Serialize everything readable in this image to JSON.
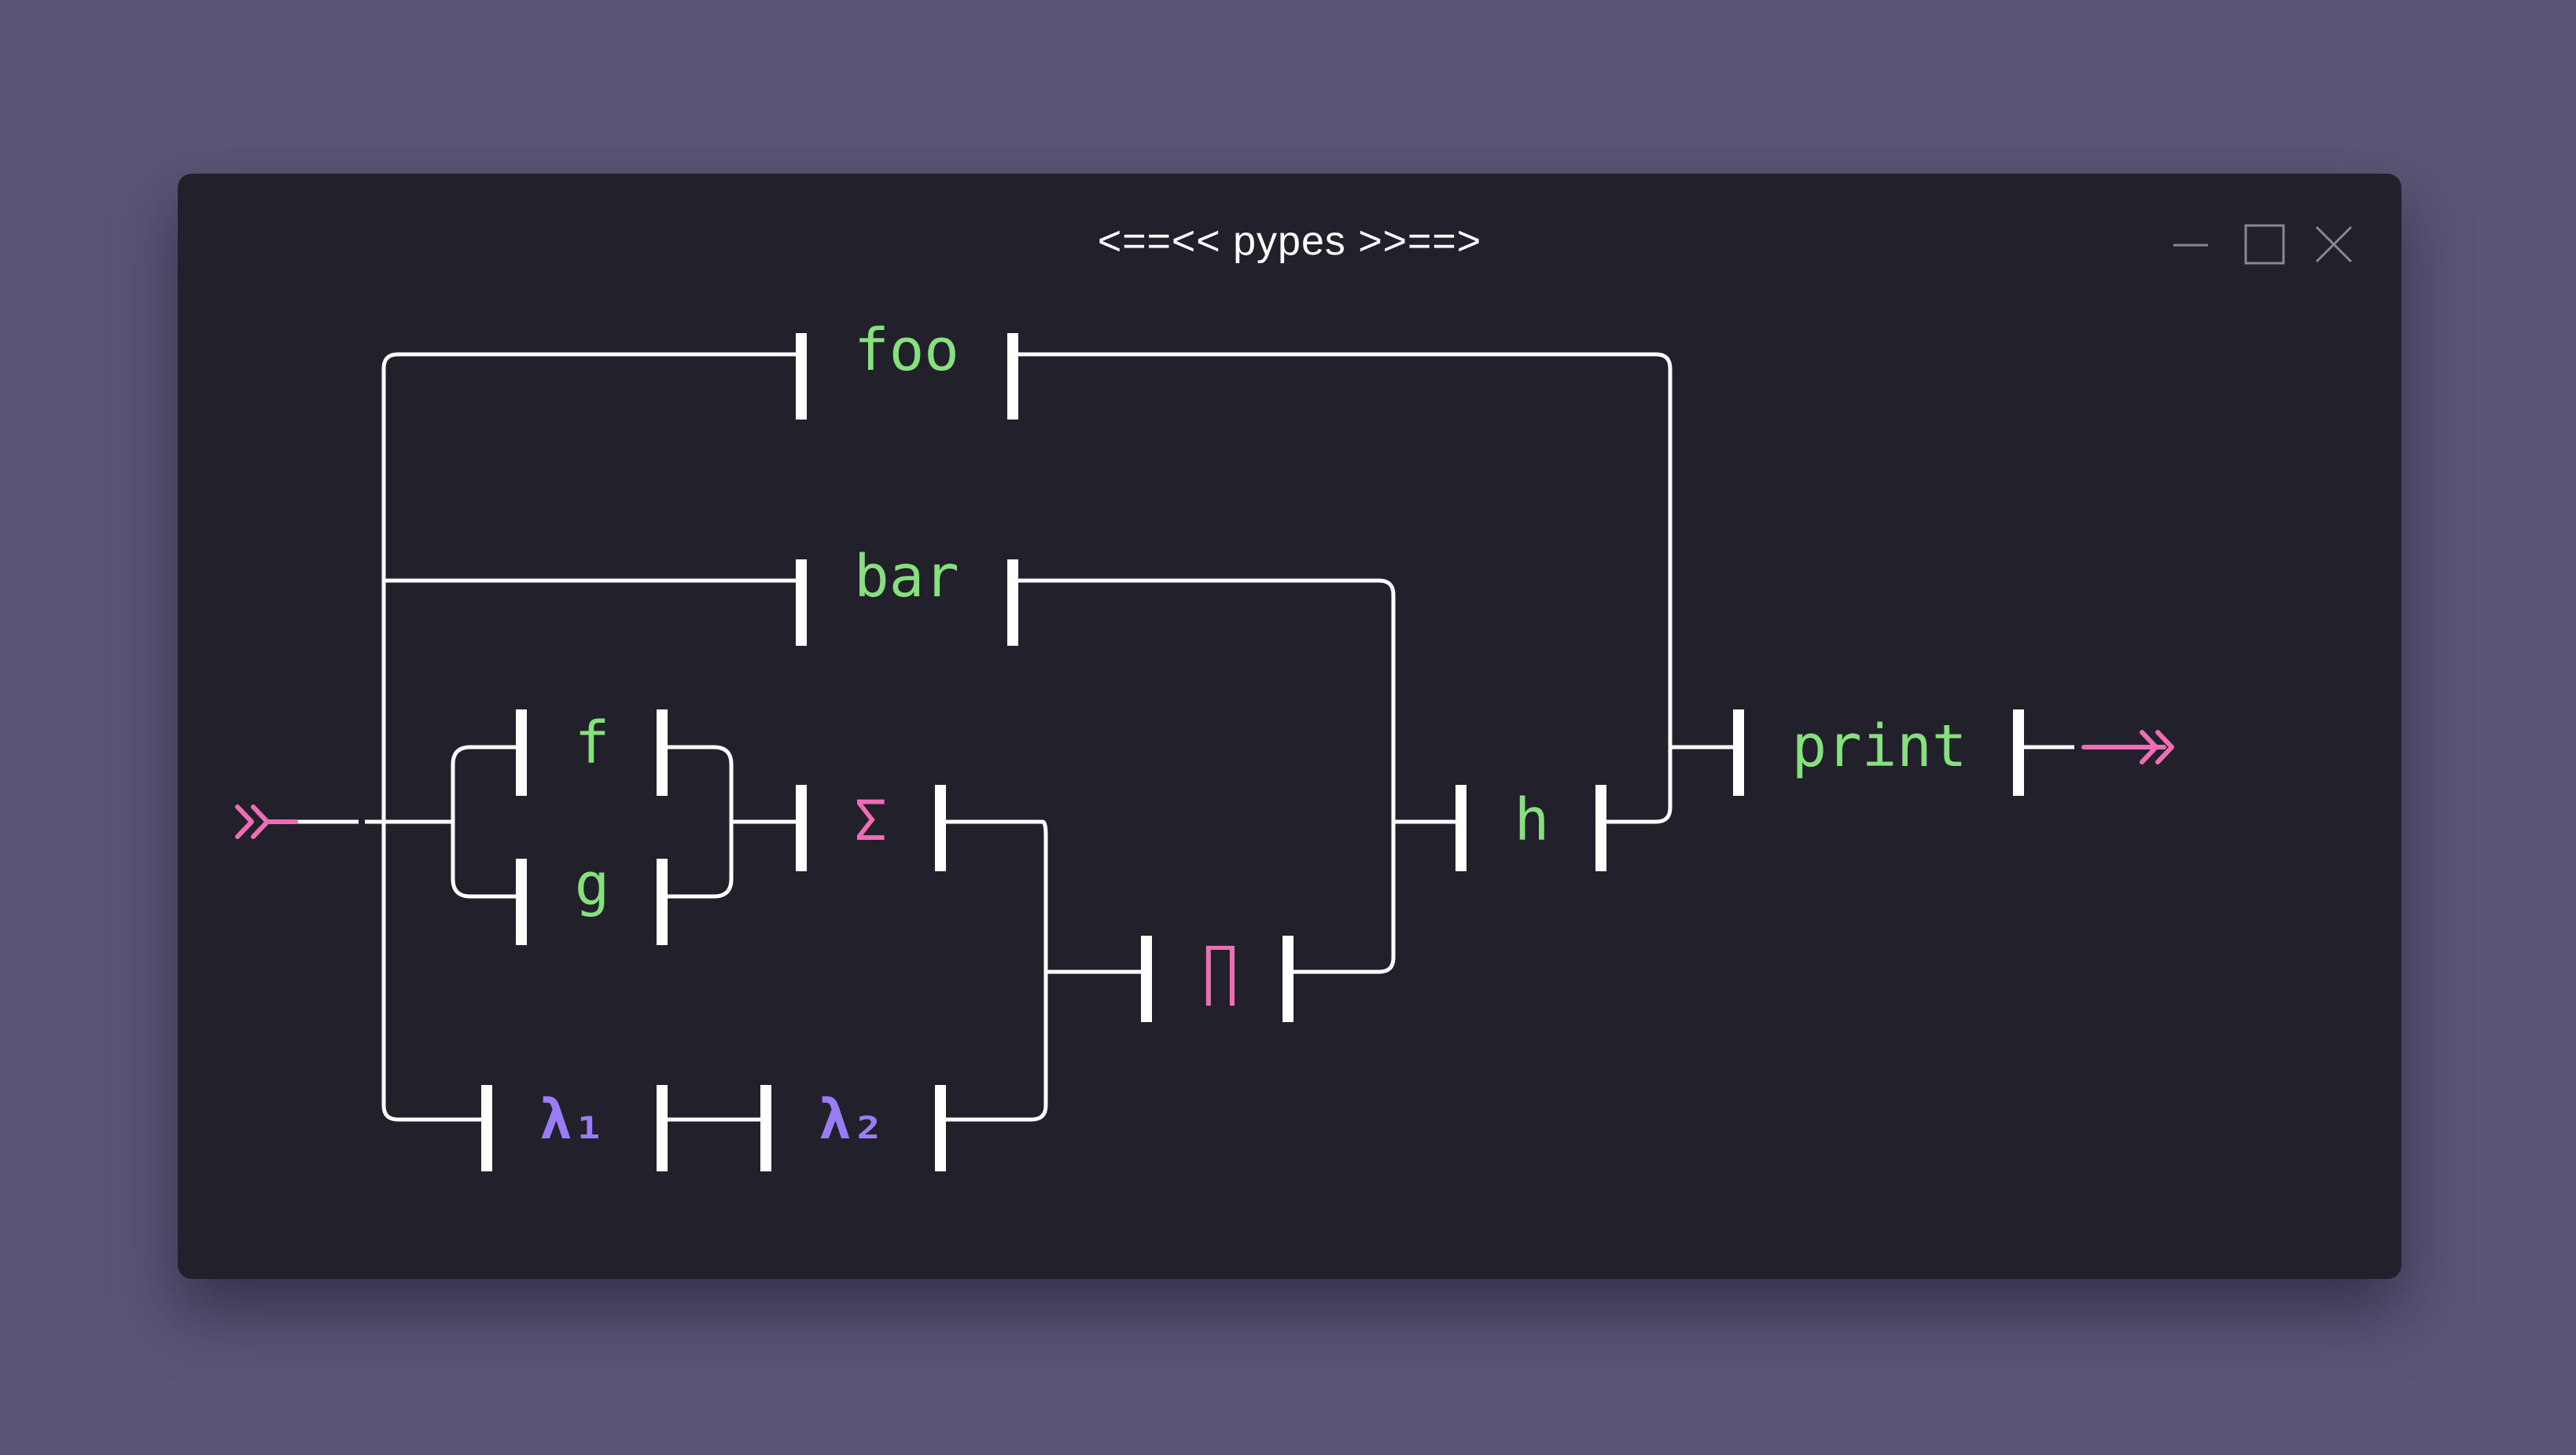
{
  "window": {
    "title": "<==<< pypes >>==>"
  },
  "controls": {
    "minimize_icon": "minimize-icon",
    "maximize_icon": "maximize-icon",
    "close_icon": "close-icon"
  },
  "colors": {
    "background": "#5a5575",
    "window": "#22202b",
    "lines": "#ffffff",
    "function_label": "#86e07d",
    "operator_label": "#f06cb4",
    "lambda_label": "#9a7cf5",
    "arrow": "#f06cb4"
  },
  "diagram": {
    "input_arrow": "»",
    "output_arrow": "—»",
    "nodes": {
      "foo": "foo",
      "bar": "bar",
      "f": "f",
      "g": "g",
      "sum": "Σ",
      "prod": "∏",
      "lambda1": "λ₁",
      "lambda2": "λ₂",
      "h": "h",
      "print": "print"
    }
  }
}
